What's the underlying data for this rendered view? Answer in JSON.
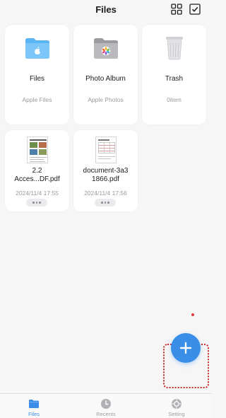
{
  "header": {
    "title": "Files"
  },
  "tiles": [
    {
      "title": "Files",
      "subtitle": "Apple Files",
      "icon": "blue-folder-icon"
    },
    {
      "title": "Photo Album",
      "subtitle": "Apple Photos",
      "icon": "photos-folder-icon"
    },
    {
      "title": "Trash",
      "subtitle": "0item",
      "icon": "trash-icon"
    }
  ],
  "documents": [
    {
      "title": "2.2 Acces...DF.pdf",
      "title_line1": "2.2",
      "title_line2": "Acces...DF.pdf",
      "date": "2024/11/4 17:55"
    },
    {
      "title": "document-3a31866.pdf",
      "title_line1": "document-3a3",
      "title_line2": "1866.pdf",
      "date": "2024/11/4 17:56"
    }
  ],
  "tabbar": {
    "items": [
      {
        "label": "Files",
        "icon": "folder-icon",
        "active": true
      },
      {
        "label": "Recents",
        "icon": "clock-icon",
        "active": false
      },
      {
        "label": "Setting",
        "icon": "settings-icon",
        "active": false
      }
    ]
  },
  "colors": {
    "accent": "#3a8ee8",
    "highlight": "#c62828"
  }
}
